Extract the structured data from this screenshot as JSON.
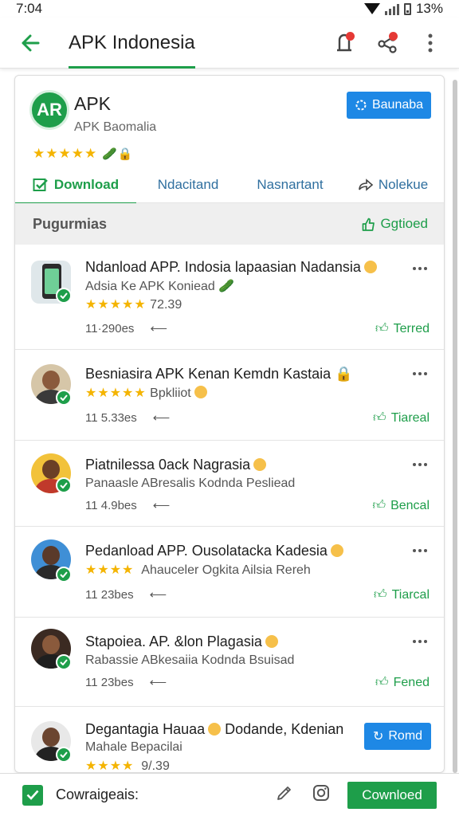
{
  "status_bar": {
    "time": "7:04",
    "battery": "13%"
  },
  "app_bar": {
    "title": "APK Indonesia"
  },
  "header": {
    "logo_text": "AR",
    "title": "APK",
    "subtitle": "APK Baomalia",
    "rating_stars": "★★★★★",
    "button_label": "Baunaba"
  },
  "tabs": [
    {
      "label": "Download",
      "active": true
    },
    {
      "label": "Ndacitand",
      "active": false
    },
    {
      "label": "Nasnartant",
      "active": false
    },
    {
      "label": "Nolekue",
      "active": false
    }
  ],
  "section": {
    "title": "Pugurmias",
    "link_label": "Ggtioed"
  },
  "items": [
    {
      "title": "Ndanload APP. Indosia lapaasian Nadansia",
      "subtitle": "Adsia Ke APK Koniead",
      "rating_stars": "★★★★★",
      "rating_value": "72.39",
      "meta": "11·290es",
      "action_label": "Terred"
    },
    {
      "title": "Besniasira APK Kenan Kemdn Kastaia",
      "subtitle": "Bpkliiot",
      "rating_stars": "★★★★★",
      "meta": "11 5.33es",
      "action_label": "Tiareal"
    },
    {
      "title": "Piatnilessa 0ack Nagrasia",
      "subtitle": "Panaasle ABresalis Kodnda Pesliead",
      "meta": "11 4.9bes",
      "action_label": "Bencal"
    },
    {
      "title": "Pedanload APP. Ousolatacka Kadesia",
      "subtitle": "Ahauceler Ogkita Ailsia Rereh",
      "rating_stars": "★★★★",
      "meta": "11 23bes",
      "action_label": "Tiarcal"
    },
    {
      "title": "Stapoiea. AP. &lon Plagasia",
      "subtitle": "Rabassie ABkesaiia Kodnda Bsuisad",
      "meta": "11 23bes",
      "action_label": "Fened"
    },
    {
      "title": "Degantagia Hauaa",
      "title_suffix": "Dodande, Kdenian",
      "subtitle": "Mahale Bepacilai",
      "rating_stars": "★★★★",
      "rating_value": "9/.39",
      "button_label": "Romd"
    }
  ],
  "bottom_bar": {
    "label": "Cowraigeais:",
    "button_label": "Cownloed"
  },
  "colors": {
    "green": "#1e9e4a",
    "blue": "#1e88e5",
    "star": "#f4b400",
    "notify": "#e53935"
  }
}
